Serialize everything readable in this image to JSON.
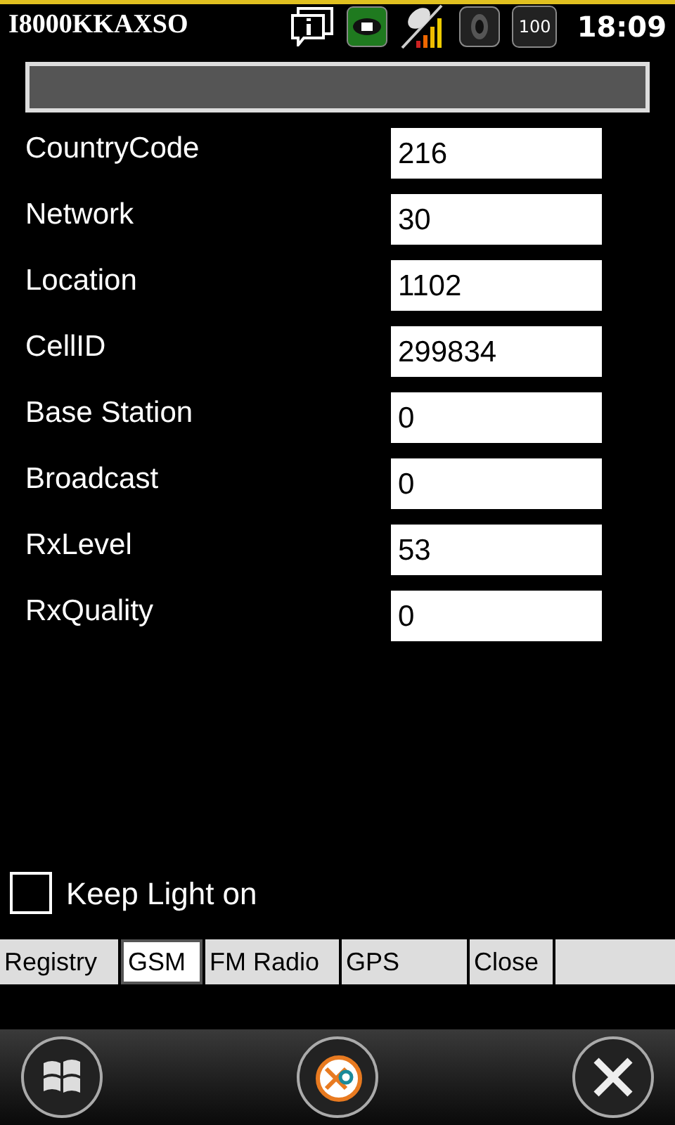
{
  "status_bar": {
    "title": "I8000KKAXSO",
    "battery": "100",
    "time": "18:09"
  },
  "fields": [
    {
      "label": "CountryCode",
      "value": "216"
    },
    {
      "label": "Network",
      "value": "30"
    },
    {
      "label": "Location",
      "value": "1102"
    },
    {
      "label": "CellID",
      "value": "299834"
    },
    {
      "label": "Base Station",
      "value": "0"
    },
    {
      "label": "Broadcast",
      "value": "0"
    },
    {
      "label": "RxLevel",
      "value": "53"
    },
    {
      "label": "RxQuality",
      "value": "0"
    }
  ],
  "keep_light": {
    "label": "Keep Light on",
    "checked": false
  },
  "tabs": [
    {
      "label": "Registry",
      "selected": false
    },
    {
      "label": "GSM",
      "selected": true
    },
    {
      "label": "FM Radio",
      "selected": false
    },
    {
      "label": "GPS",
      "selected": false
    },
    {
      "label": "Close",
      "selected": false
    }
  ]
}
